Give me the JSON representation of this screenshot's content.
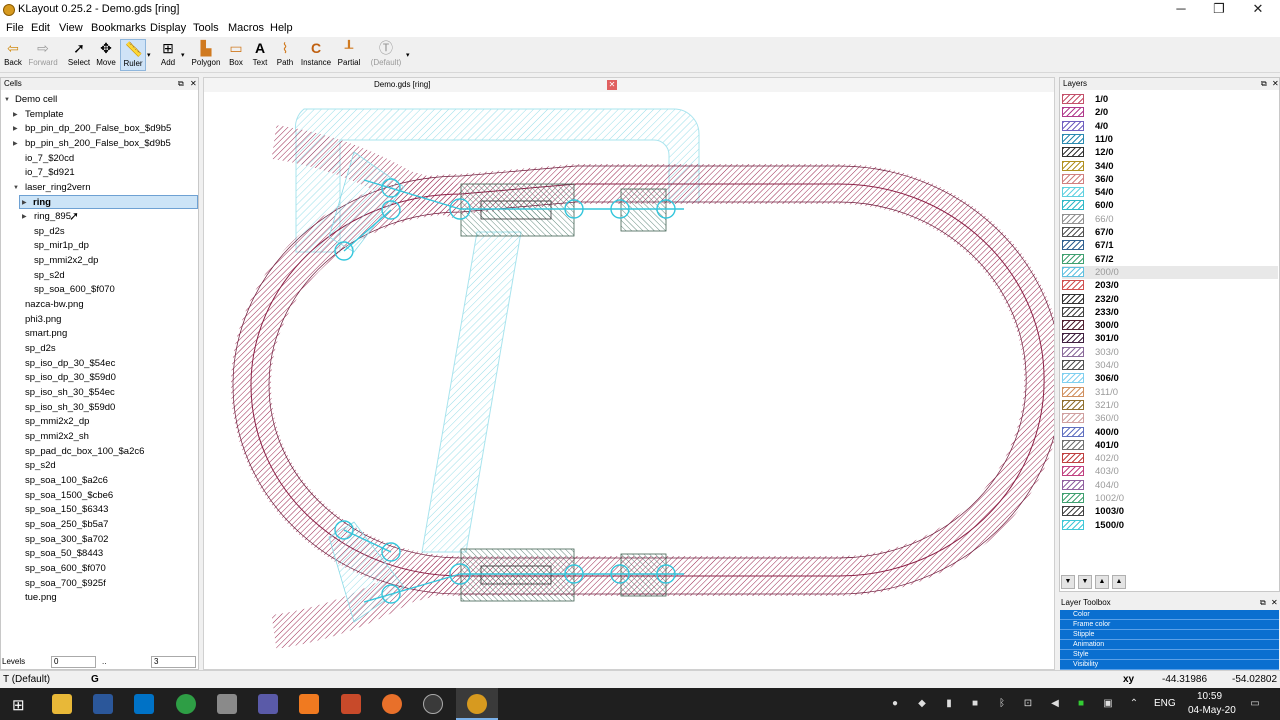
{
  "window": {
    "title": "KLayout 0.25.2 - Demo.gds [ring]",
    "min": "─",
    "max": "❐",
    "close": "✕"
  },
  "menu": [
    "File",
    "Edit",
    "View",
    "Bookmarks",
    "Display",
    "Tools",
    "Macros",
    "Help"
  ],
  "toolbar": {
    "back": "Back",
    "forward": "Forward",
    "select": "Select",
    "move": "Move",
    "ruler": "Ruler",
    "add": "Add",
    "polygon": "Polygon",
    "box": "Box",
    "text": "Text",
    "path": "Path",
    "instance": "Instance",
    "partial": "Partial",
    "default": "(Default)"
  },
  "cells": {
    "title": "Cells",
    "items": [
      {
        "label": "Demo cell"
      },
      {
        "label": "Template"
      },
      {
        "label": "bp_pin_dp_200_False_box_$d9b5"
      },
      {
        "label": "bp_pin_sh_200_False_box_$d9b5"
      },
      {
        "label": "io_7_$20cd"
      },
      {
        "label": "io_7_$d921"
      },
      {
        "label": "laser_ring2vern"
      },
      {
        "label": "ring"
      },
      {
        "label": "ring_895"
      },
      {
        "label": "sp_d2s"
      },
      {
        "label": "sp_mir1p_dp"
      },
      {
        "label": "sp_mmi2x2_dp"
      },
      {
        "label": "sp_s2d"
      },
      {
        "label": "sp_soa_600_$f070"
      },
      {
        "label": "nazca-bw.png"
      },
      {
        "label": "phi3.png"
      },
      {
        "label": "smart.png"
      },
      {
        "label": "sp_d2s"
      },
      {
        "label": "sp_iso_dp_30_$54ec"
      },
      {
        "label": "sp_iso_dp_30_$59d0"
      },
      {
        "label": "sp_iso_sh_30_$54ec"
      },
      {
        "label": "sp_iso_sh_30_$59d0"
      },
      {
        "label": "sp_mmi2x2_dp"
      },
      {
        "label": "sp_mmi2x2_sh"
      },
      {
        "label": "sp_pad_dc_box_100_$a2c6"
      },
      {
        "label": "sp_s2d"
      },
      {
        "label": "sp_soa_100_$a2c6"
      },
      {
        "label": "sp_soa_1500_$cbe6"
      },
      {
        "label": "sp_soa_150_$6343"
      },
      {
        "label": "sp_soa_250_$b5a7"
      },
      {
        "label": "sp_soa_300_$a702"
      },
      {
        "label": "sp_soa_50_$8443"
      },
      {
        "label": "sp_soa_600_$f070"
      },
      {
        "label": "sp_soa_700_$925f"
      },
      {
        "label": "tue.png"
      }
    ],
    "levels_label": "Levels",
    "levels_from": "0",
    "levels_sep": "..",
    "levels_to": "3"
  },
  "view": {
    "tab": "Demo.gds [ring]",
    "tab_close": "✕"
  },
  "layers": {
    "title": "Layers",
    "items": [
      {
        "name": "1/0",
        "color": "#c4506a"
      },
      {
        "name": "2/0",
        "color": "#b03a8c"
      },
      {
        "name": "4/0",
        "color": "#7060c0"
      },
      {
        "name": "11/0",
        "color": "#2a8ab0"
      },
      {
        "name": "12/0",
        "color": "#303030"
      },
      {
        "name": "34/0",
        "color": "#b09020"
      },
      {
        "name": "36/0",
        "color": "#d08080"
      },
      {
        "name": "54/0",
        "color": "#60d0e0"
      },
      {
        "name": "60/0",
        "color": "#30b8c8"
      },
      {
        "name": "66/0",
        "color": "#909090"
      },
      {
        "name": "67/0",
        "color": "#505050"
      },
      {
        "name": "67/1",
        "color": "#306090"
      },
      {
        "name": "67/2",
        "color": "#40a070"
      },
      {
        "name": "200/0",
        "color": "#60c0e0"
      },
      {
        "name": "203/0",
        "color": "#d05050"
      },
      {
        "name": "232/0",
        "color": "#303030"
      },
      {
        "name": "233/0",
        "color": "#404040"
      },
      {
        "name": "300/0",
        "color": "#502030"
      },
      {
        "name": "301/0",
        "color": "#402040"
      },
      {
        "name": "303/0",
        "color": "#8a6a9a"
      },
      {
        "name": "304/0",
        "color": "#505050"
      },
      {
        "name": "306/0",
        "color": "#80d0f0"
      },
      {
        "name": "311/0",
        "color": "#d09060"
      },
      {
        "name": "321/0",
        "color": "#907030"
      },
      {
        "name": "360/0",
        "color": "#d0a0a0"
      },
      {
        "name": "400/0",
        "color": "#6070c0"
      },
      {
        "name": "401/0",
        "color": "#707070"
      },
      {
        "name": "402/0",
        "color": "#c04040"
      },
      {
        "name": "403/0",
        "color": "#c04080"
      },
      {
        "name": "404/0",
        "color": "#9060a0"
      },
      {
        "name": "1002/0",
        "color": "#40a070"
      },
      {
        "name": "1003/0",
        "color": "#404040"
      },
      {
        "name": "1500/0",
        "color": "#40c8d8"
      }
    ]
  },
  "layer_toolbox": {
    "title": "Layer Toolbox",
    "rows": [
      "Color",
      "Frame color",
      "Stipple",
      "Animation",
      "Style",
      "Visibility"
    ]
  },
  "status": {
    "mode": "T (Default)",
    "grid": "G",
    "coord_label": "xy",
    "x": "-44.31986",
    "y": "-54.02802"
  },
  "taskbar": {
    "lang": "ENG",
    "time": "10:59",
    "date": "04-May-20"
  },
  "colors": {
    "accent": "#0a6fd0",
    "waveguide": "#8b2046",
    "cyan": "#34c6dc"
  }
}
